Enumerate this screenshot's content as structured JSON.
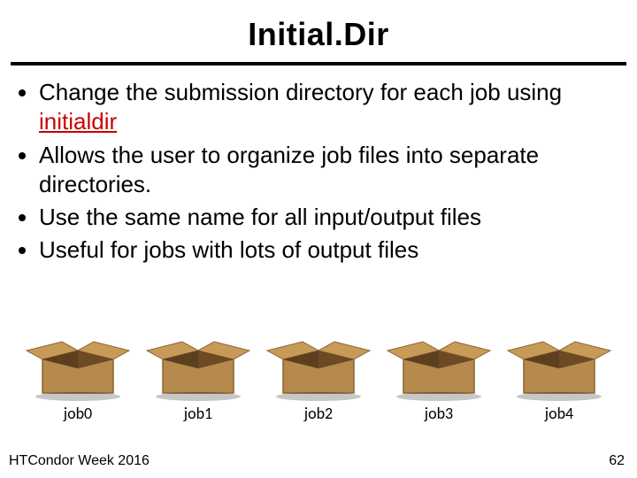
{
  "title": "Initial.Dir",
  "bullets": {
    "b1_pre": "Change the submission directory for each job using ",
    "b1_kw": "initialdir",
    "b2": "Allows the user to organize job files into separate directories.",
    "b3": "Use the same name for all input/output files",
    "b4": "Useful for jobs with lots of output files"
  },
  "boxes": [
    "job0",
    "job1",
    "job2",
    "job3",
    "job4"
  ],
  "footer": {
    "left": "HTCondor Week 2016",
    "right": "62"
  }
}
